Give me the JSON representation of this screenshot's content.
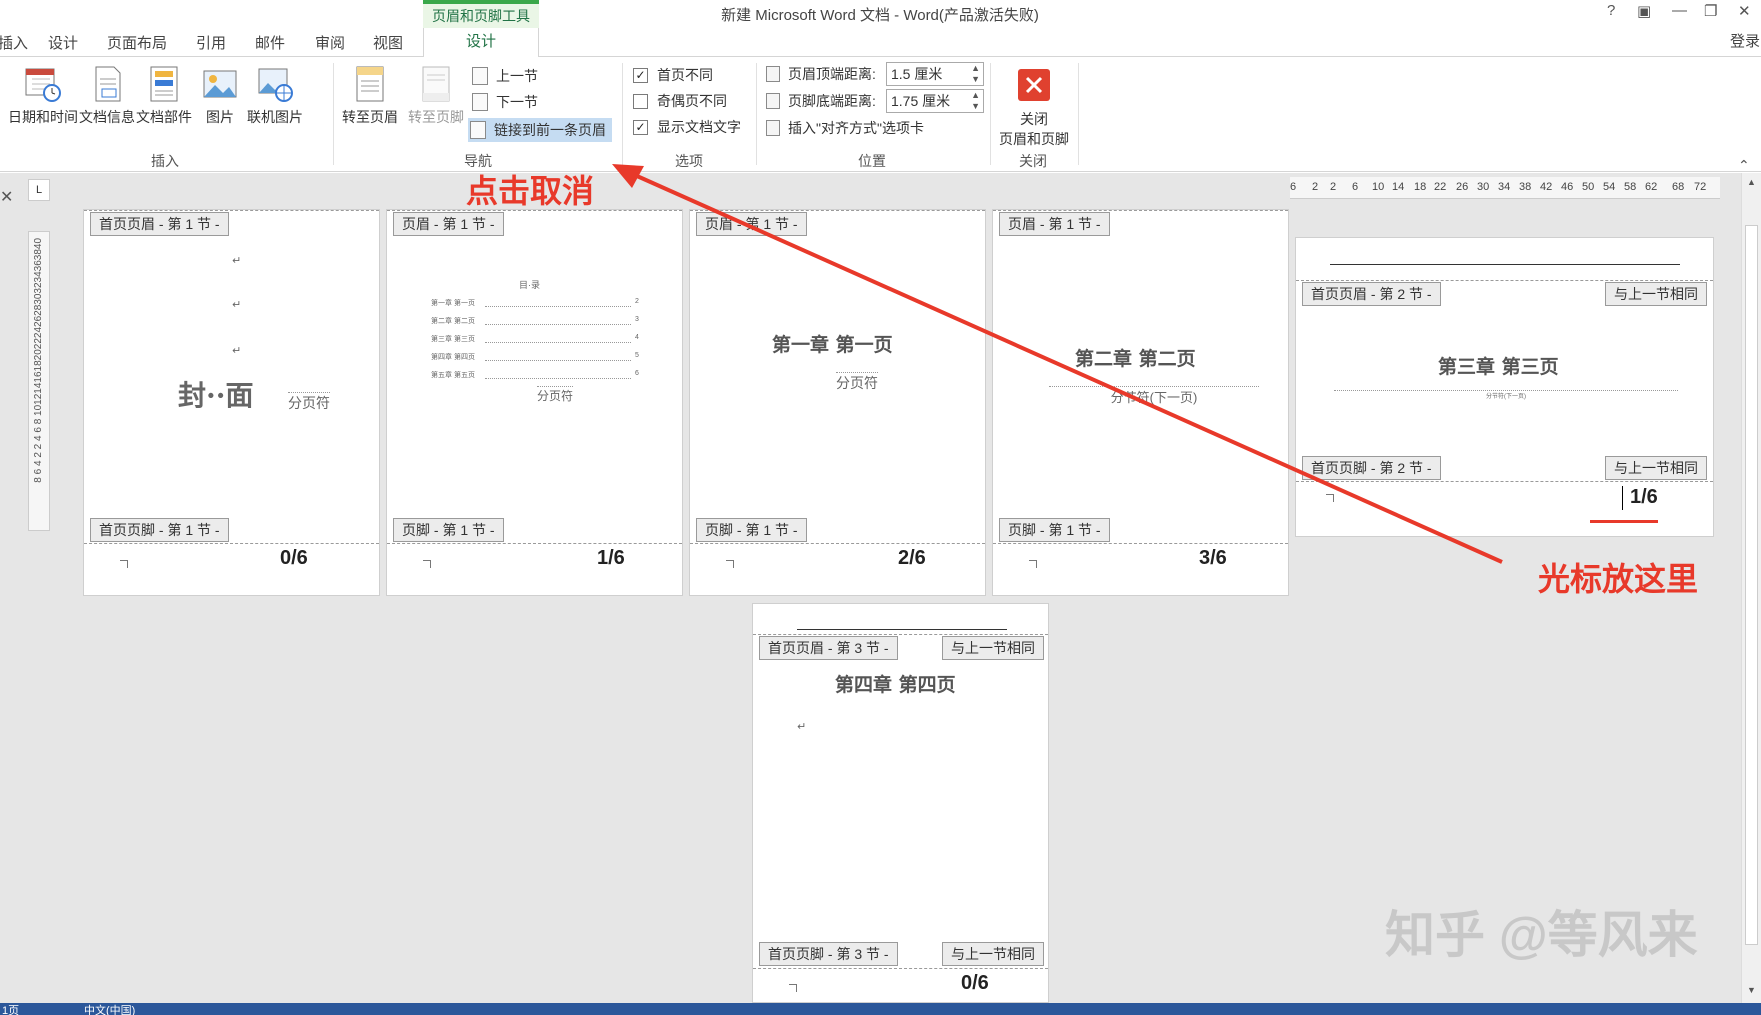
{
  "window": {
    "title": "新建 Microsoft Word 文档 - Word(产品激活失败)",
    "context_group": "页眉和页脚工具",
    "help": "?",
    "login": "登录"
  },
  "tabs": [
    "插入",
    "设计",
    "页面布局",
    "引用",
    "邮件",
    "审阅",
    "视图"
  ],
  "active_tab": "设计",
  "ribbon": {
    "insert": {
      "buttons": [
        "日期和时间",
        "文档信息",
        "文档部件",
        "图片",
        "联机图片"
      ],
      "label": "插入"
    },
    "nav": {
      "goto_header": "转至页眉",
      "goto_footer": "转至页脚",
      "prev_section": "上一节",
      "next_section": "下一节",
      "link_previous": "链接到前一条页眉",
      "label": "导航"
    },
    "options": {
      "first_page_diff": "首页不同",
      "odd_even_diff": "奇偶页不同",
      "show_doc_text": "显示文档文字",
      "first_page_checked": true,
      "odd_even_checked": false,
      "show_text_checked": true,
      "label": "选项"
    },
    "position": {
      "header_top_label": "页眉顶端距离:",
      "header_top_value": "1.5 厘米",
      "footer_bottom_label": "页脚底端距离:",
      "footer_bottom_value": "1.75 厘米",
      "insert_align_tab": "插入\"对齐方式\"选项卡",
      "label": "位置"
    },
    "close": {
      "button_line1": "关闭",
      "button_line2": "页眉和页脚",
      "label": "关闭"
    }
  },
  "ruler": {
    "corner": "L",
    "vertical": "8 6 4 2   2 4 6 8 10121416182022242628303234363840",
    "horizontal": [
      "6",
      "2",
      "2",
      "6",
      "10",
      "14",
      "18",
      "22",
      "26",
      "30",
      "34",
      "38",
      "42",
      "46",
      "50",
      "54",
      "58",
      "62",
      "68",
      "72"
    ]
  },
  "pages": {
    "p1": {
      "header_tag": "首页页眉 - 第 1 节 -",
      "footer_tag": "首页页脚 - 第 1 节 -",
      "title": "封··面",
      "break": "分页符",
      "page_num": "0/6"
    },
    "p2": {
      "header_tag": "页眉 - 第 1 节 -",
      "footer_tag": "页脚 - 第 1 节 -",
      "toc_title": "目·录",
      "toc": [
        "第一章 第一页",
        "第二章 第二页",
        "第三章 第三页",
        "第四章 第四页",
        "第五章 第五页"
      ],
      "toc_pages": [
        "2",
        "3",
        "4",
        "5",
        "6"
      ],
      "break": "分页符",
      "page_num": "1/6"
    },
    "p3": {
      "header_tag": "页眉 - 第 1 节 -",
      "footer_tag": "页脚 - 第 1 节 -",
      "title": "第一章 第一页",
      "break": "分页符",
      "page_num": "2/6"
    },
    "p4": {
      "header_tag": "页眉 - 第 1 节 -",
      "footer_tag": "页脚 - 第 1 节 -",
      "title": "第二章 第二页",
      "break": "分节符(下一页)",
      "page_num": "3/6"
    },
    "p5": {
      "header_tag": "首页页眉 - 第 2 节 -",
      "header_same": "与上一节相同",
      "footer_tag": "首页页脚 - 第 2 节 -",
      "footer_same": "与上一节相同",
      "title": "第三章 第三页",
      "break": "分节符(下一页)",
      "page_num": "1/6"
    },
    "p6": {
      "header_tag": "首页页眉 - 第 3 节 -",
      "header_same": "与上一节相同",
      "footer_tag": "首页页脚 - 第 3 节 -",
      "footer_same": "与上一节相同",
      "title": "第四章 第四页",
      "page_num": "0/6"
    }
  },
  "annotations": {
    "click_cancel": "点击取消",
    "cursor_here": "光标放这里",
    "color": "#e8392a"
  },
  "watermark": "知乎 @等风来",
  "statusbar": {
    "page_info": "1页",
    "lang": "中文(中国)"
  }
}
